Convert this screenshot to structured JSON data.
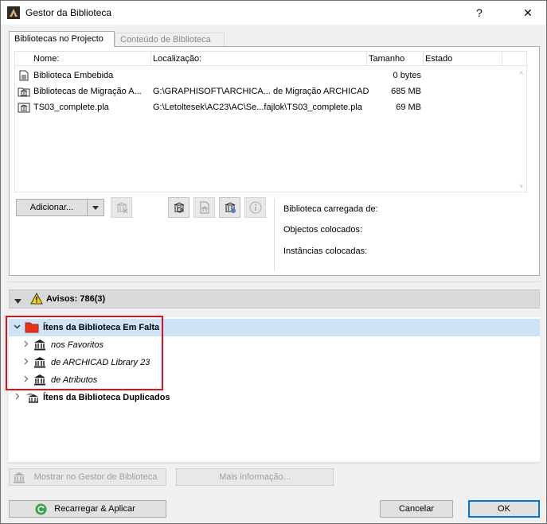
{
  "window": {
    "title": "Gestor da Biblioteca",
    "help_label": "?",
    "close_label": "✕",
    "app_icon": "archicad-icon"
  },
  "tabs": [
    {
      "label": "Bibliotecas no Projecto",
      "active": true
    },
    {
      "label": "Conteúdo de Biblioteca",
      "active": false
    }
  ],
  "list": {
    "columns": [
      "Nome:",
      "Localização:",
      "Tamanho",
      "Estado"
    ],
    "rows": [
      {
        "name": "Biblioteca Embebida",
        "location": "",
        "size": "0 bytes",
        "status": "",
        "icon": "embedded-library-icon"
      },
      {
        "name": "Bibliotecas de Migração A...",
        "location": "G:\\GRAPHISOFT\\ARCHICA... de Migração ARCHICAD",
        "size": "685 MB",
        "status": "",
        "icon": "folder-library-icon"
      },
      {
        "name": "TS03_complete.pla",
        "location": "G:\\Letoltesek\\AC23\\AC\\Se...fajlok\\TS03_complete.pla",
        "size": "69 MB",
        "status": "",
        "icon": "pla-library-icon"
      }
    ]
  },
  "toolbar": {
    "add_label": "Adicionar...",
    "add_dropdown_icon": "triangle-down-icon"
  },
  "info": {
    "loaded_from": "Biblioteca carregada de:",
    "objects_placed": "Objectos colocados:",
    "instances_placed": "Instâncias colocadas:"
  },
  "warnings": {
    "label": "Avisos: 786(3)",
    "icon": "warning-icon"
  },
  "tree": {
    "missing": "Ítens da Biblioteca Em Falta",
    "missing_children": [
      "nos Favoritos",
      "de ARCHICAD Library 23",
      "de Atributos"
    ],
    "duplicated": "Ítens da Biblioteca Duplicados"
  },
  "bottom": {
    "show_in_manager": "Mostrar no Gestor de Biblioteca",
    "more_info": "Mais informação...",
    "reload_apply": "Recarregar & Aplicar",
    "cancel": "Cancelar",
    "ok": "OK"
  },
  "colors": {
    "selection": "#cce4f7",
    "highlight_box": "#e0101c",
    "folder_red": "#e8321c",
    "ok_border": "#0078d7"
  }
}
